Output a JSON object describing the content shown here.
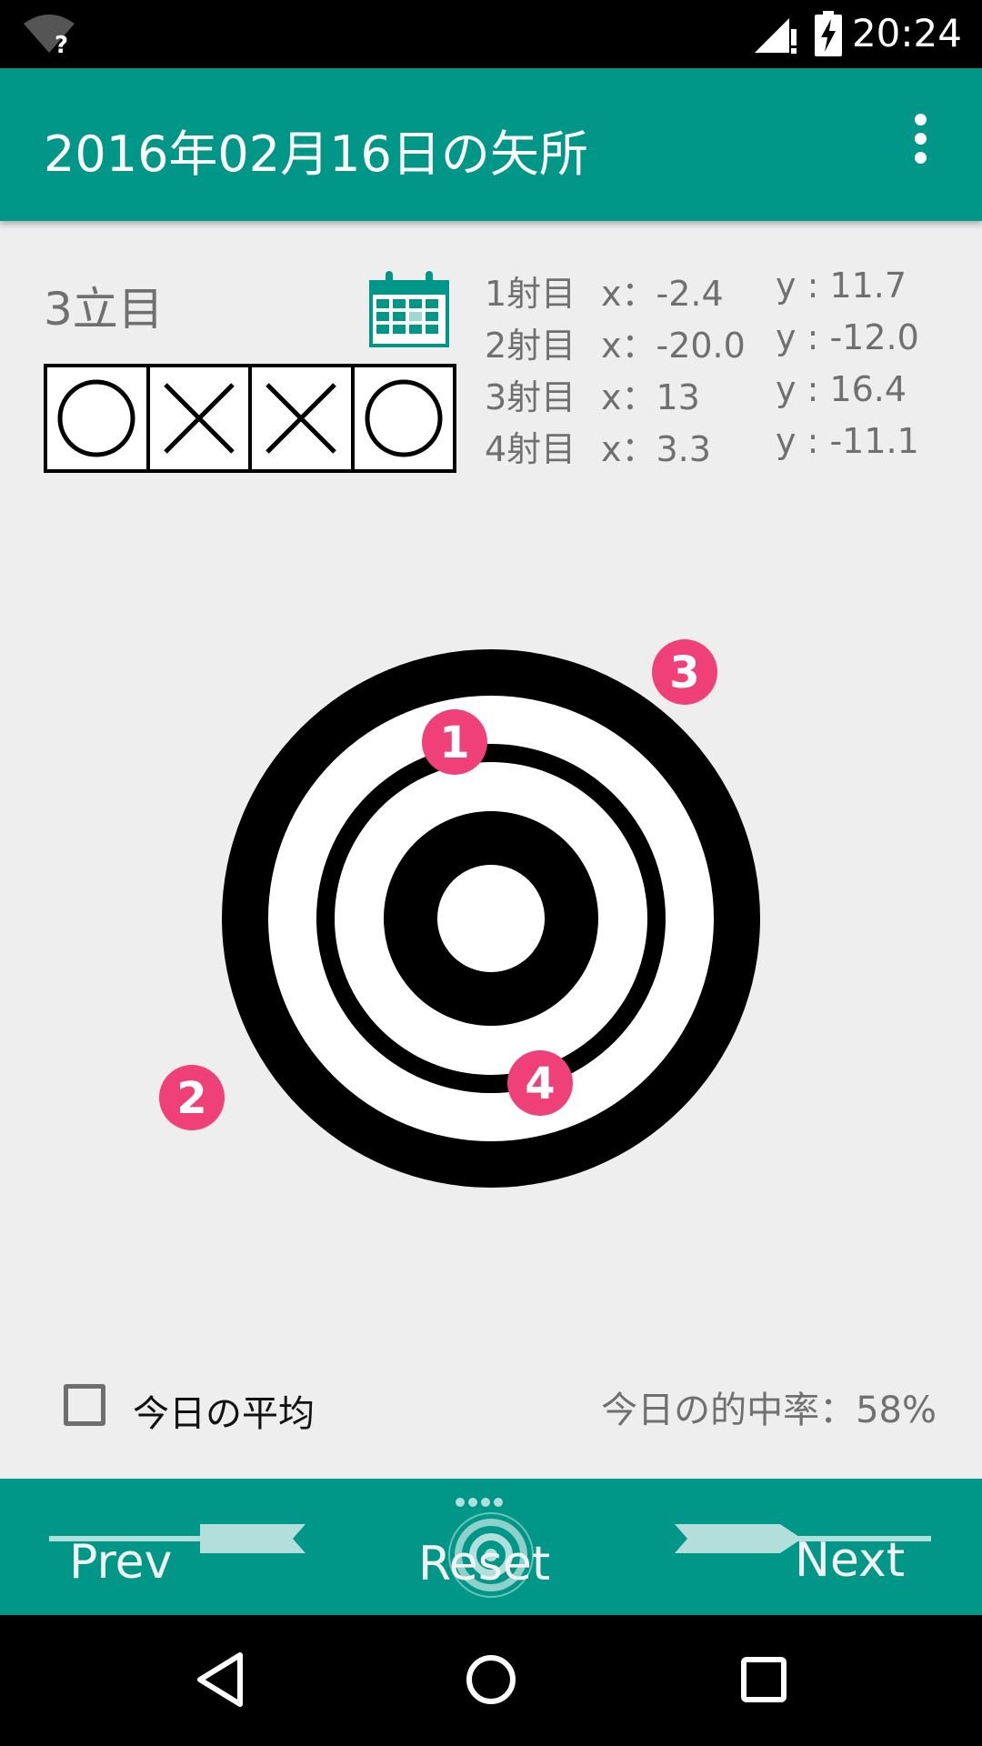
{
  "status": {
    "time": "20:24"
  },
  "appbar": {
    "title": "2016年02月16日の矢所"
  },
  "round": {
    "label": "3立目",
    "results": [
      "hit",
      "miss",
      "miss",
      "hit"
    ]
  },
  "shots": [
    {
      "label": "1射目",
      "x": "x：-2.4",
      "y": "y : 11.7"
    },
    {
      "label": "2射目",
      "x": "x：-20.0",
      "y": "y : -12.0"
    },
    {
      "label": "3射目",
      "x": "x：13",
      "y": "y : 16.4"
    },
    {
      "label": "4射目",
      "x": "x：3.3",
      "y": "y : -11.1"
    }
  ],
  "markers": [
    "1",
    "2",
    "3",
    "4"
  ],
  "controls": {
    "average_label": "今日の平均",
    "hit_rate": "今日の的中率：58%"
  },
  "nav": {
    "prev": "Prev",
    "reset": "Reset",
    "next": "Next"
  },
  "colors": {
    "accent": "#009688",
    "marker": "#f0407a"
  }
}
